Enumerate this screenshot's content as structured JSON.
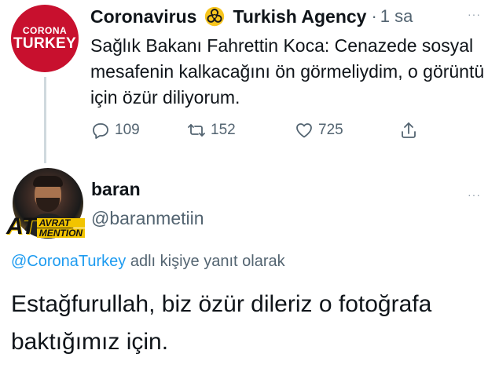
{
  "tweet1": {
    "avatar_line1": "CORONA",
    "avatar_line2": "TURKEY",
    "name_part1": "Coronavirus",
    "name_part2": "Turkish Agency",
    "separator": "·",
    "time": "1 sa",
    "more": "···",
    "text": "Sağlık Bakanı Fahrettin Koca: Cenazede sosyal mesafenin kalkacağını ön görmeliydim, o görüntü için özür diliyorum.",
    "replies": "109",
    "retweets": "152",
    "likes": "725"
  },
  "tweet2": {
    "badge_big": "AT",
    "badge_line1": "AVRAT",
    "badge_line2": "MENTION",
    "name": "baran",
    "handle": "@baranmetiin",
    "more": "···",
    "mention": "@CoronaTurkey",
    "replying_suffix": " adlı kişiye yanıt olarak",
    "text": "Estağfurullah, biz özür dileriz o fotoğrafa baktığımız için."
  },
  "colors": {
    "brand_red": "#c8102e",
    "link_blue": "#1d9bf0",
    "muted_gray": "#536471",
    "badge_yellow": "#f2c400"
  }
}
